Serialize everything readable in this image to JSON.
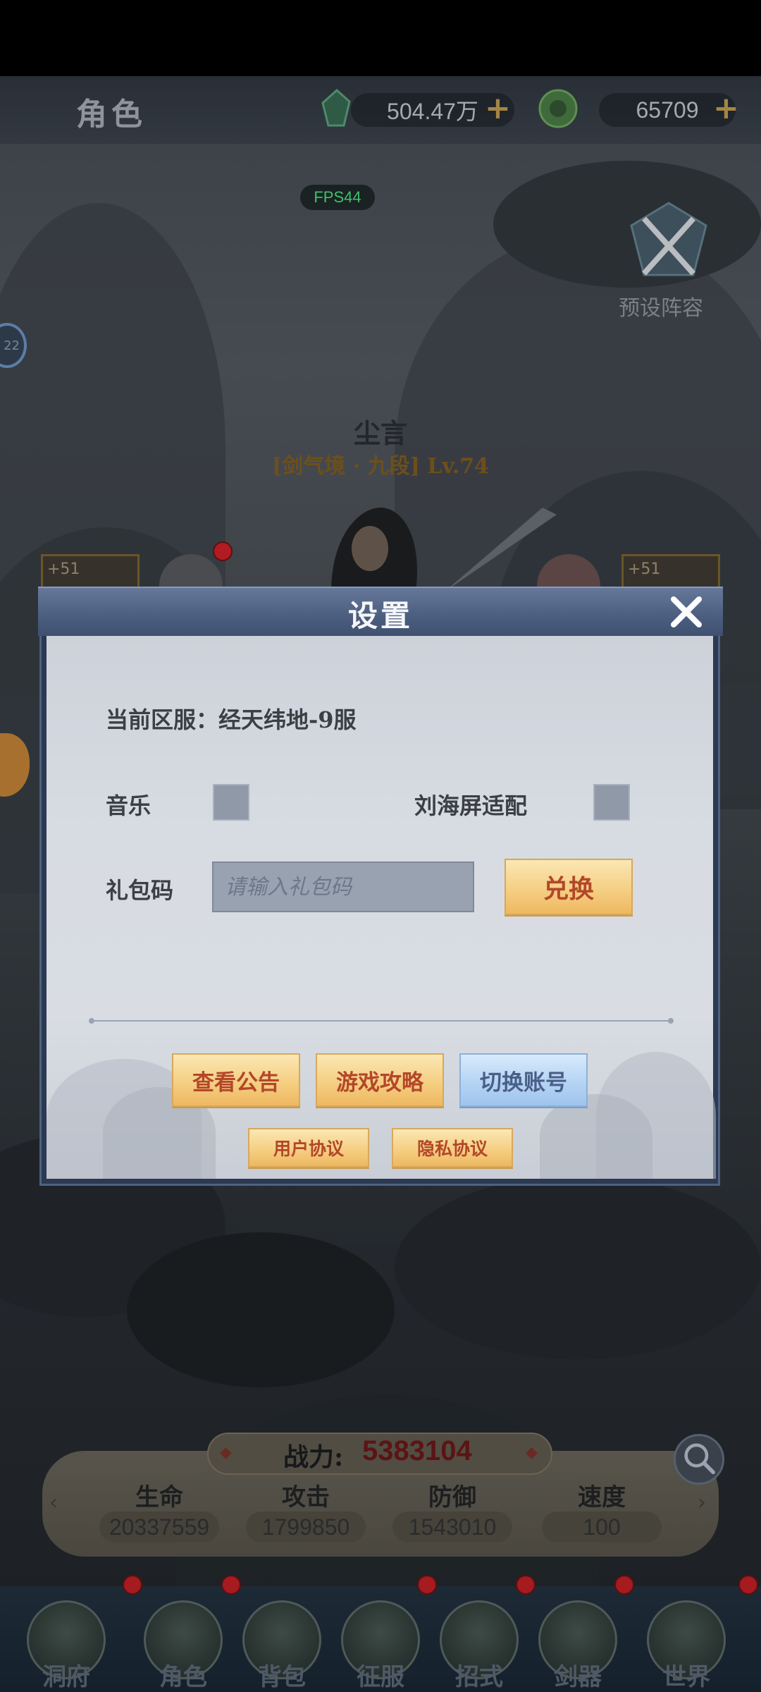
{
  "top_bar": {
    "title": "角色",
    "jade_amount": "504.47万",
    "coin_amount": "65709",
    "plus_symbol": "+"
  },
  "fps": "FPS44",
  "preset": {
    "label": "预设阵容",
    "icon": "crossed-swords-icon"
  },
  "side_badge": "22",
  "character": {
    "name": "尘言",
    "level": "[剑气境 · 九段] Lv.74"
  },
  "equipment": {
    "left_bonus": "+51",
    "right_bonus": "+51"
  },
  "dialog": {
    "title": "设置",
    "server_label": "当前区服：经天纬地-9服",
    "music_label": "音乐",
    "notch_label": "刘海屏适配",
    "gift_label": "礼包码",
    "gift_placeholder": "请输入礼包码",
    "redeem_button": "兑换",
    "buttons": {
      "announcement": "查看公告",
      "guide": "游戏攻略",
      "switch_account": "切换账号",
      "user_agreement": "用户协议",
      "privacy": "隐私协议"
    },
    "music_checked": false,
    "notch_checked": false
  },
  "stats": {
    "power_label": "战力:",
    "power_value": "5383104",
    "items": [
      {
        "name": "生命",
        "value": "20337559"
      },
      {
        "name": "攻击",
        "value": "1799850"
      },
      {
        "name": "防御",
        "value": "1543010"
      },
      {
        "name": "速度",
        "value": "100"
      }
    ]
  },
  "nav": [
    {
      "label": "洞府",
      "icon": "pavilion-icon"
    },
    {
      "label": "角色",
      "icon": "character-icon"
    },
    {
      "label": "背包",
      "icon": "bag-icon"
    },
    {
      "label": "征服",
      "icon": "crossed-swords-icon"
    },
    {
      "label": "招式",
      "icon": "scroll-icon"
    },
    {
      "label": "剑器",
      "icon": "sword-icon"
    },
    {
      "label": "世界",
      "icon": "world-map-icon"
    }
  ],
  "colors": {
    "dialog_header": "#4c5e80",
    "gold_button": "#f5cf83",
    "blue_button": "#b5d4f3",
    "power_value": "#5b1414",
    "fps_text": "#3fc06d",
    "notification_dot": "#a51b1f"
  }
}
